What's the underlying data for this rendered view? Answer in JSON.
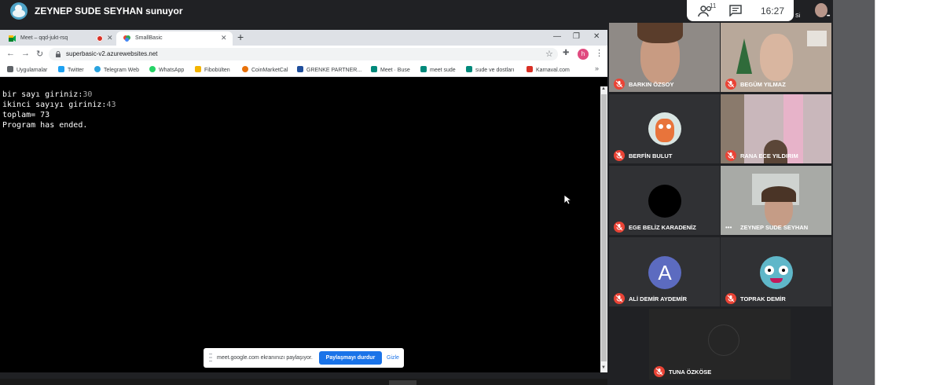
{
  "meet": {
    "presenter_label": "ZEYNEP SUDE SEYHAN sunuyor",
    "participant_count": "11",
    "time": "16:27",
    "self_label": "Si",
    "share_bar": {
      "message": "meet.google.com ekranınızı paylaşıyor.",
      "stop_label": "Paylaşmayı durdur",
      "hide_label": "Gizle"
    }
  },
  "browser": {
    "tabs": [
      {
        "title": "Meet – qqd-jukt-rsq",
        "close": "✕"
      },
      {
        "title": "SmallBasic",
        "close": "✕"
      }
    ],
    "new_tab": "+",
    "url": "superbasic-v2.azurewebsites.net",
    "profile_initial": "h",
    "bookmarks": [
      {
        "label": "Uygulamalar",
        "color": "#5f6368"
      },
      {
        "label": "Twitter",
        "color": "#1da1f2"
      },
      {
        "label": "Telegram Web",
        "color": "#2aa3df"
      },
      {
        "label": "WhatsApp",
        "color": "#25d366"
      },
      {
        "label": "Fibobülten",
        "color": "#f4b400"
      },
      {
        "label": "CoinMarketCal",
        "color": "#e8710a"
      },
      {
        "label": "GRENKE PARTNER...",
        "color": "#1f4e9c"
      },
      {
        "label": "Meet · Buse",
        "color": "#00897b"
      },
      {
        "label": "meet sude",
        "color": "#00897b"
      },
      {
        "label": "sude ve dostları",
        "color": "#00897b"
      },
      {
        "label": "Karnaval.com",
        "color": "#d93025"
      }
    ],
    "bookmark_more": "»"
  },
  "console": {
    "lines": [
      {
        "prompt": "bir sayı giriniz:",
        "input": "30"
      },
      {
        "prompt": "ikinci sayıyı giriniz:",
        "input": "43"
      },
      {
        "prompt": "toplam= 73",
        "input": ""
      },
      {
        "prompt": "Program has ended.",
        "input": ""
      }
    ]
  },
  "participants": [
    {
      "name": "BARKIN ÖZSOY"
    },
    {
      "name": "BEGÜM YILMAZ"
    },
    {
      "name": "BERFİN BULUT"
    },
    {
      "name": "RANA ECE YILDIRIM"
    },
    {
      "name": "EGE BELİZ KARADENİZ"
    },
    {
      "name": "ZEYNEP SUDE SEYHAN"
    },
    {
      "name": "ALİ DEMİR AYDEMİR",
      "avatar_letter": "A"
    },
    {
      "name": "TOPRAK DEMİR"
    },
    {
      "name": "TUNA ÖZKÖSE"
    }
  ],
  "colors": {
    "meet_bg": "#202124",
    "tile_bg": "#3c4043",
    "mic_off": "#ea4335",
    "accent_blue": "#1a73e8",
    "letter_avatar": "#5c6bc0"
  }
}
